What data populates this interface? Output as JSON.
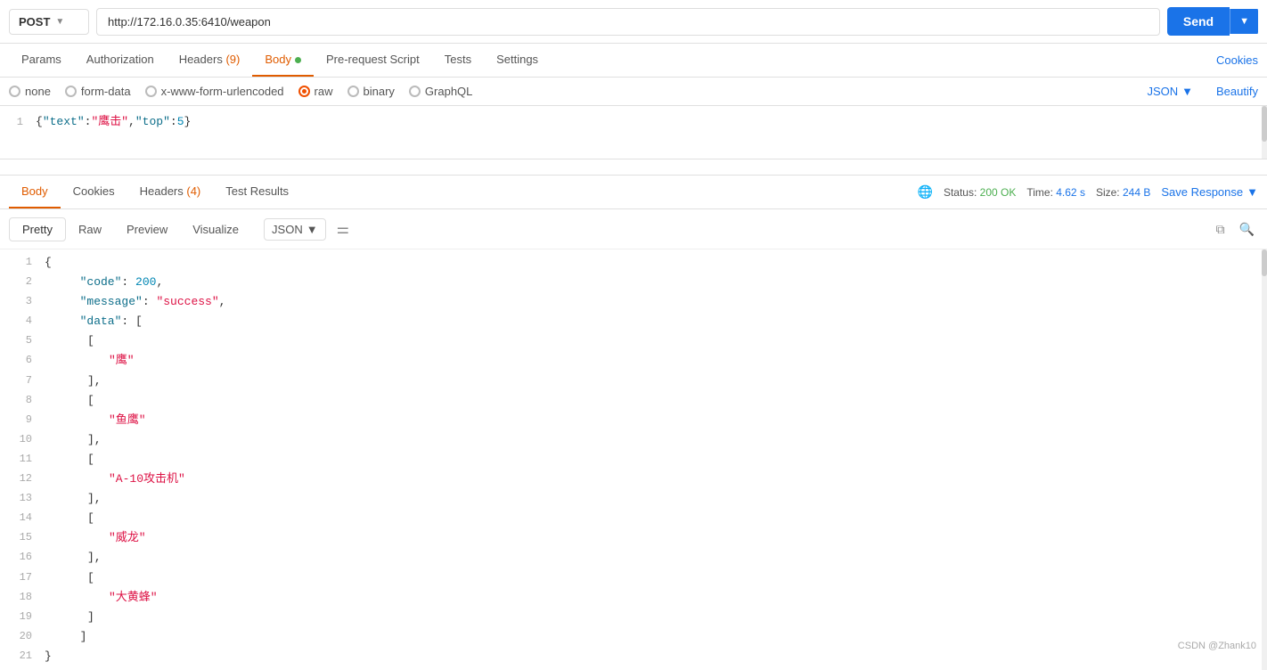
{
  "urlBar": {
    "method": "POST",
    "url": "http://172.16.0.35:6410/weapon",
    "sendLabel": "Send"
  },
  "reqTabs": [
    {
      "label": "Params",
      "active": false,
      "badge": null,
      "dot": false
    },
    {
      "label": "Authorization",
      "active": false,
      "badge": null,
      "dot": false
    },
    {
      "label": "Headers",
      "active": false,
      "badge": "(9)",
      "dot": false
    },
    {
      "label": "Body",
      "active": true,
      "badge": null,
      "dot": true
    },
    {
      "label": "Pre-request Script",
      "active": false,
      "badge": null,
      "dot": false
    },
    {
      "label": "Tests",
      "active": false,
      "badge": null,
      "dot": false
    },
    {
      "label": "Settings",
      "active": false,
      "badge": null,
      "dot": false
    }
  ],
  "cookiesLink": "Cookies",
  "bodyTypes": [
    {
      "id": "none",
      "label": "none",
      "selected": false
    },
    {
      "id": "form-data",
      "label": "form-data",
      "selected": false
    },
    {
      "id": "x-www-form-urlencoded",
      "label": "x-www-form-urlencoded",
      "selected": false
    },
    {
      "id": "raw",
      "label": "raw",
      "selected": true
    },
    {
      "id": "binary",
      "label": "binary",
      "selected": false
    },
    {
      "id": "GraphQL",
      "label": "GraphQL",
      "selected": false
    }
  ],
  "bodyFormat": "JSON",
  "beautifyLabel": "Beautify",
  "requestBody": "{\"text\":\"鹰击\",\"top\":5}",
  "respTabs": [
    {
      "label": "Body",
      "active": true,
      "badge": null
    },
    {
      "label": "Cookies",
      "active": false,
      "badge": null
    },
    {
      "label": "Headers",
      "active": false,
      "badge": "(4)"
    },
    {
      "label": "Test Results",
      "active": false,
      "badge": null
    }
  ],
  "respMeta": {
    "statusLabel": "Status:",
    "statusValue": "200 OK",
    "timeLabel": "Time:",
    "timeValue": "4.62 s",
    "sizeLabel": "Size:",
    "sizeValue": "244 B"
  },
  "saveResponse": "Save Response",
  "viewTabs": [
    {
      "label": "Pretty",
      "active": true
    },
    {
      "label": "Raw",
      "active": false
    },
    {
      "label": "Preview",
      "active": false
    },
    {
      "label": "Visualize",
      "active": false
    }
  ],
  "respFormat": "JSON",
  "responseLines": [
    {
      "num": 1,
      "content": "{",
      "type": "punc",
      "indent": 0
    },
    {
      "num": 2,
      "content": "\"code\": 200,",
      "type": "mixed",
      "indent": 1
    },
    {
      "num": 3,
      "content": "\"message\": \"success\",",
      "type": "mixed",
      "indent": 1
    },
    {
      "num": 4,
      "content": "\"data\": [",
      "type": "mixed",
      "indent": 1
    },
    {
      "num": 5,
      "content": "[",
      "type": "punc",
      "indent": 2
    },
    {
      "num": 6,
      "content": "\"鹰\"",
      "type": "str",
      "indent": 3
    },
    {
      "num": 7,
      "content": "],",
      "type": "punc",
      "indent": 2
    },
    {
      "num": 8,
      "content": "[",
      "type": "punc",
      "indent": 2
    },
    {
      "num": 9,
      "content": "\"鱼鹰\"",
      "type": "str",
      "indent": 3
    },
    {
      "num": 10,
      "content": "],",
      "type": "punc",
      "indent": 2
    },
    {
      "num": 11,
      "content": "[",
      "type": "punc",
      "indent": 2
    },
    {
      "num": 12,
      "content": "\"A-10攻击机\"",
      "type": "str",
      "indent": 3
    },
    {
      "num": 13,
      "content": "],",
      "type": "punc",
      "indent": 2
    },
    {
      "num": 14,
      "content": "[",
      "type": "punc",
      "indent": 2
    },
    {
      "num": 15,
      "content": "\"威龙\"",
      "type": "str",
      "indent": 3
    },
    {
      "num": 16,
      "content": "],",
      "type": "punc",
      "indent": 2
    },
    {
      "num": 17,
      "content": "[",
      "type": "punc",
      "indent": 2
    },
    {
      "num": 18,
      "content": "\"大黄蜂\"",
      "type": "str",
      "indent": 3
    },
    {
      "num": 19,
      "content": "]",
      "type": "punc",
      "indent": 2
    },
    {
      "num": 20,
      "content": "]",
      "type": "punc",
      "indent": 1
    },
    {
      "num": 21,
      "content": "}",
      "type": "punc",
      "indent": 0
    }
  ],
  "watermark": "CSDN @Zhank10"
}
